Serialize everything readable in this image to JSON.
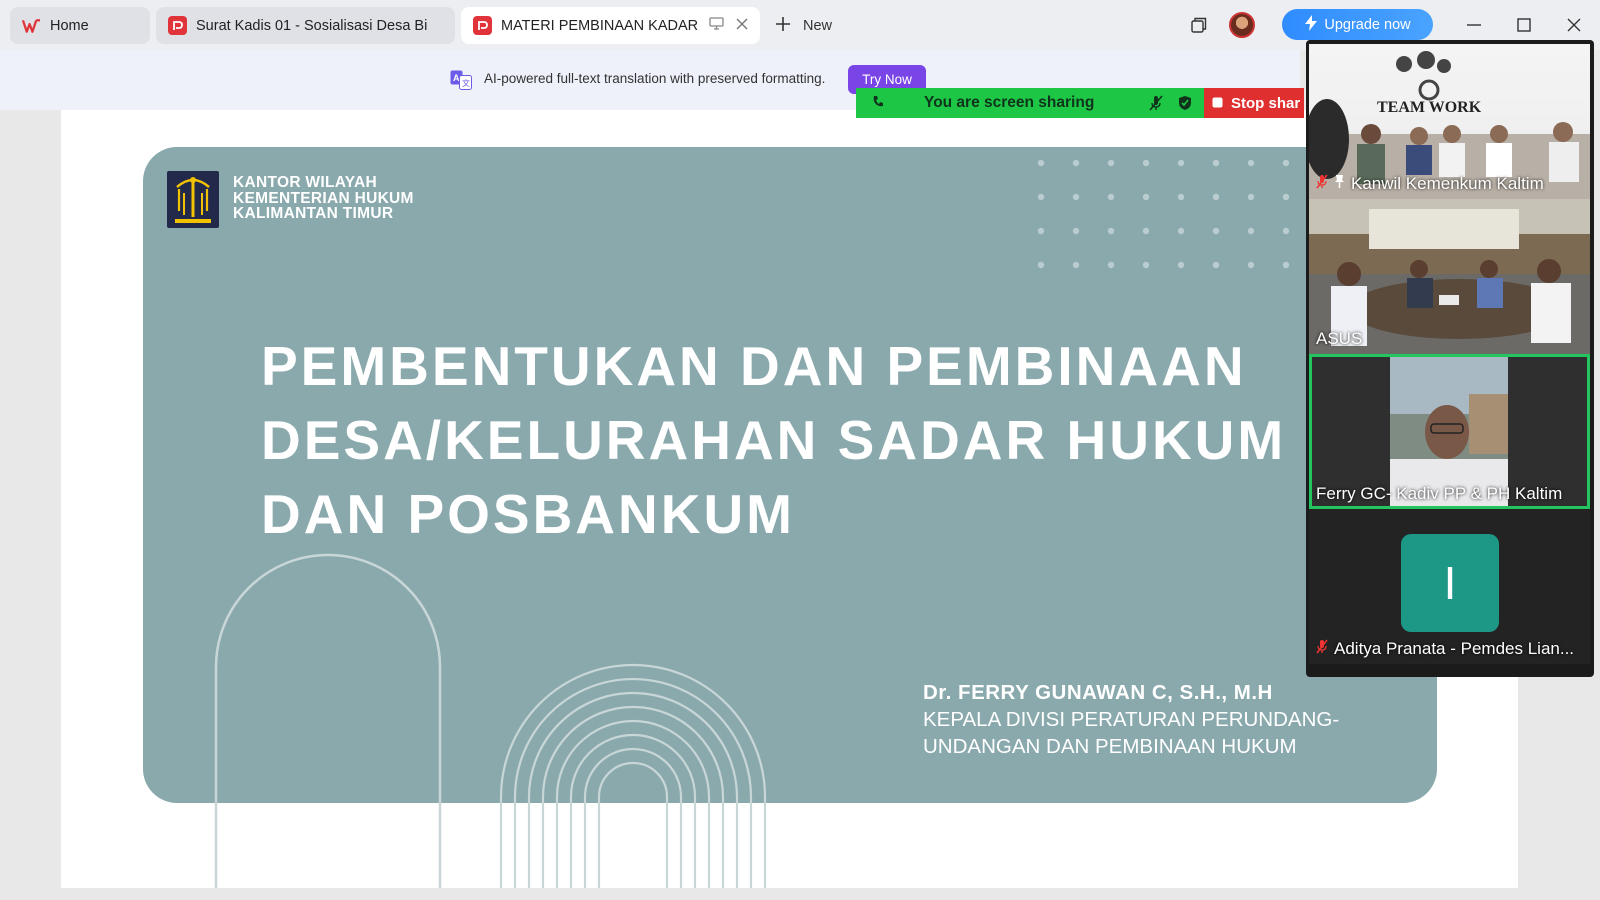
{
  "tabs": [
    {
      "label": "Home",
      "icon": "wps-logo-icon"
    },
    {
      "label": "Surat Kadis 01  - Sosialisasi Desa Bi",
      "icon": "pdf-icon"
    },
    {
      "label": "MATERI PEMBINAAN KADAR",
      "icon": "pdf-icon",
      "active": true
    }
  ],
  "new_tab_label": "New",
  "upgrade_label": "Upgrade now",
  "translation_banner": {
    "text": "AI-powered full-text translation with preserved formatting.",
    "button": "Try Now"
  },
  "screen_share": {
    "status": "You are screen sharing",
    "stop_label": "Stop shar",
    "colors": {
      "bar": "#1ec646",
      "stop": "#e02f2f"
    }
  },
  "slide": {
    "org_lines": [
      "KANTOR WILAYAH",
      "KEMENTERIAN HUKUM",
      "KALIMANTAN TIMUR"
    ],
    "title_lines": [
      "PEMBENTUKAN DAN PEMBINAAN",
      "DESA/KELURAHAN SADAR HUKUM",
      "DAN POSBANKUM"
    ],
    "presenter_name": "Dr. FERRY GUNAWAN C, S.H., M.H",
    "presenter_role_lines": [
      "KEPALA DIVISI PERATURAN PERUNDANG-",
      "UNDANGAN DAN PEMBINAAN HUKUM"
    ],
    "bg_color": "#8aa9ad"
  },
  "participants": [
    {
      "name": "Kanwil Kemenkum Kaltim",
      "muted": true,
      "pinned": true
    },
    {
      "name": "ASUS",
      "muted": false,
      "pinned": false
    },
    {
      "name": "Ferry GC- Kadiv PP & PH Kaltim",
      "muted": false,
      "pinned": false,
      "speaking": true
    },
    {
      "name": "Aditya Pranata - Pemdes Lian...",
      "muted": true,
      "pinned": false,
      "avatar_letter": "I"
    }
  ],
  "slide_banner_text": "TEAM WORK"
}
